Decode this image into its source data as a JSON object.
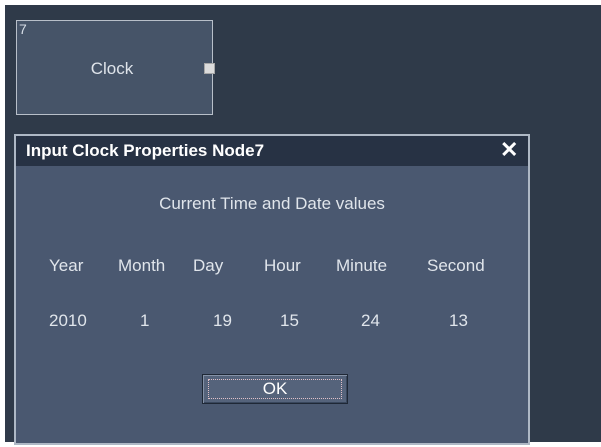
{
  "node": {
    "id": "7",
    "title": "Clock"
  },
  "dialog": {
    "title": "Input Clock Properties Node7",
    "close_symbol": "✕",
    "subtitle": "Current Time and Date values",
    "columns": [
      "Year",
      "Month",
      "Day",
      "Hour",
      "Minute",
      "Second"
    ],
    "values": [
      "2010",
      "1",
      "19",
      "15",
      "24",
      "13"
    ],
    "ok_label": "OK"
  },
  "colors": {
    "canvas": "#2f3a49",
    "dialog": "#4a5870",
    "titlebar": "#273244"
  }
}
